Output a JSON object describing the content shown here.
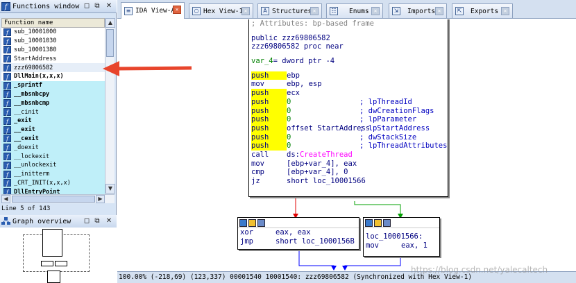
{
  "functions_window": {
    "title": "Functions window",
    "column_header": "Function name",
    "items": [
      {
        "name": "sub_10001000",
        "lib": false,
        "bold": false
      },
      {
        "name": "sub_10001030",
        "lib": false,
        "bold": false
      },
      {
        "name": "sub_10001380",
        "lib": false,
        "bold": false
      },
      {
        "name": "StartAddress",
        "lib": false,
        "bold": false
      },
      {
        "name": "zzz69806582",
        "lib": false,
        "bold": false
      },
      {
        "name": "DllMain(x,x,x)",
        "lib": false,
        "bold": true
      },
      {
        "name": "_sprintf",
        "lib": true,
        "bold": true
      },
      {
        "name": "__mbsnbcpy",
        "lib": true,
        "bold": true
      },
      {
        "name": "__mbsnbcmp",
        "lib": true,
        "bold": true
      },
      {
        "name": "__cinit",
        "lib": true,
        "bold": false
      },
      {
        "name": "_exit",
        "lib": true,
        "bold": true
      },
      {
        "name": "__exit",
        "lib": true,
        "bold": true
      },
      {
        "name": "__cexit",
        "lib": true,
        "bold": true
      },
      {
        "name": "_doexit",
        "lib": true,
        "bold": false
      },
      {
        "name": "__lockexit",
        "lib": true,
        "bold": false
      },
      {
        "name": "__unlockexit",
        "lib": true,
        "bold": false
      },
      {
        "name": "__initterm",
        "lib": true,
        "bold": false
      },
      {
        "name": "_CRT_INIT(x,x,x)",
        "lib": true,
        "bold": false
      },
      {
        "name": "DllEntryPoint",
        "lib": true,
        "bold": true
      }
    ],
    "status": "Line 5 of 143"
  },
  "graph_overview": {
    "title": "Graph overview"
  },
  "tabs": [
    {
      "label": "IDA View-A",
      "active": true
    },
    {
      "label": "Hex View-1",
      "active": false
    },
    {
      "label": "Structures",
      "active": false
    },
    {
      "label": "Enums",
      "active": false
    },
    {
      "label": "Imports",
      "active": false
    },
    {
      "label": "Exports",
      "active": false
    }
  ],
  "main_block": {
    "attr_comment": "; Attributes: bp-based frame",
    "public_line": "public zzz69806582",
    "proc_line": "zzz69806582 proc near",
    "var_name": "var_4",
    "var_def": "= dword ptr -4",
    "ins": [
      {
        "m": "push",
        "op": "ebp",
        "hl": true
      },
      {
        "m": "mov",
        "op": "ebp, esp",
        "hl": false
      },
      {
        "m": "push",
        "op": "ecx",
        "hl": true
      },
      {
        "m": "push",
        "op": "0",
        "cmt": "; lpThreadId",
        "hl": true
      },
      {
        "m": "push",
        "op": "0",
        "cmt": "; dwCreationFlags",
        "hl": true
      },
      {
        "m": "push",
        "op": "0",
        "cmt": "; lpParameter",
        "hl": true
      },
      {
        "m": "push",
        "op": "offset StartAddress",
        "cmt": "; lpStartAddress",
        "hl": true
      },
      {
        "m": "push",
        "op": "0",
        "cmt": "; dwStackSize",
        "hl": true
      },
      {
        "m": "push",
        "op": "0",
        "cmt": "; lpThreadAttributes",
        "hl": true
      },
      {
        "m": "call",
        "op": "ds:",
        "api": "CreateThread",
        "hl": false
      },
      {
        "m": "mov",
        "op": "[ebp+var_4], eax",
        "hl": false
      },
      {
        "m": "cmp",
        "op": "[ebp+var_4], 0",
        "hl": false
      },
      {
        "m": "jz",
        "op": "short loc_10001566",
        "hl": false
      }
    ]
  },
  "left_block": {
    "l1_m": "xor",
    "l1_op": "eax, eax",
    "l2_m": "jmp",
    "l2_op": "short loc_1000156B"
  },
  "right_block": {
    "label": "loc_10001566:",
    "l1_m": "mov",
    "l1_op": "eax, 1"
  },
  "status_bar": "100.00% (-218,69) (123,337) 00001540 10001540: zzz69806582 (Synchronized with Hex View-1)",
  "watermark": "https://blog.csdn.net/yalecaltech",
  "colors": {
    "arrow": "#e8452c",
    "true_edge": "#00a000",
    "false_edge": "#e00000",
    "join_edge": "#0000ff",
    "highlight": "#ffff00"
  }
}
